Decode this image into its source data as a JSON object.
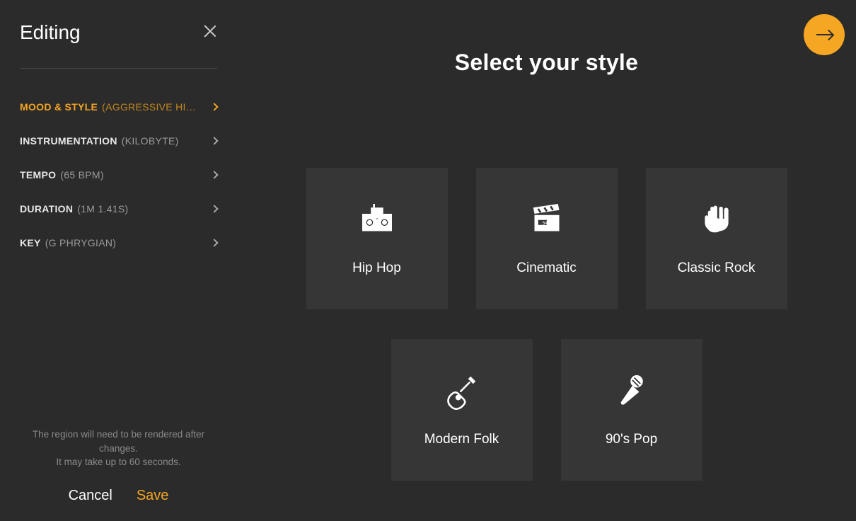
{
  "sidebar": {
    "title": "Editing",
    "menu": [
      {
        "label": "Mood & Style",
        "value": "(AGGRESSIVE HIP H…",
        "active": true
      },
      {
        "label": "Instrumentation",
        "value": "(KILOBYTE)",
        "active": false
      },
      {
        "label": "Tempo",
        "value": "(65 BPM)",
        "active": false
      },
      {
        "label": "Duration",
        "value": "(1M 1.41S)",
        "active": false
      },
      {
        "label": "Key",
        "value": "(G PHRYGIAN)",
        "active": false
      }
    ],
    "footer_note_line1": "The region will need to be rendered after changes.",
    "footer_note_line2": "It may take up to 60 seconds.",
    "cancel_label": "Cancel",
    "save_label": "Save"
  },
  "main": {
    "title": "Select your style",
    "styles_row1": [
      {
        "name": "Hip Hop",
        "icon": "boombox"
      },
      {
        "name": "Cinematic",
        "icon": "clapperboard"
      },
      {
        "name": "Classic Rock",
        "icon": "rock-hand"
      }
    ],
    "styles_row2": [
      {
        "name": "Modern Folk",
        "icon": "guitar"
      },
      {
        "name": "90's Pop",
        "icon": "microphone"
      }
    ]
  },
  "colors": {
    "accent": "#f5a623",
    "bg": "#2b2b2b",
    "card": "#363636"
  }
}
